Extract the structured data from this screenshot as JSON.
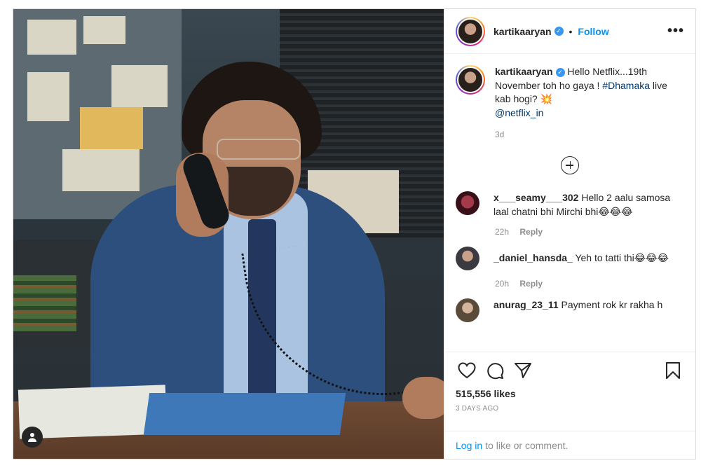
{
  "post": {
    "username": "kartikaaryan",
    "follow_label": "Follow",
    "separator": "•",
    "more_icon": "•••"
  },
  "caption": {
    "username": "kartikaaryan",
    "text_1": "Hello Netflix...19th November toh ho gaya ! ",
    "hashtag": "#Dhamaka",
    "text_2": " live kab hogi? 💥",
    "mention": "@netflix_in",
    "age": "3d"
  },
  "comments": [
    {
      "username": "x___seamy___302",
      "text": "Hello 2 aalu samosa laal chatni bhi Mirchi bhi😂😂😂",
      "age": "22h",
      "reply": "Reply",
      "avatar_color": "#6b1f2a"
    },
    {
      "username": "_daniel_hansda_",
      "text": "Yeh to tatti thi😂😂😂",
      "age": "20h",
      "reply": "Reply",
      "avatar_color": "#4a4a52"
    },
    {
      "username": "anurag_23_11",
      "text": "Payment rok kr rakha h",
      "age": "",
      "reply": "",
      "avatar_color": "#7a6a58"
    }
  ],
  "stats": {
    "likes": "515,556 likes",
    "posted": "3 DAYS AGO"
  },
  "login": {
    "link": "Log in",
    "text": "to like or comment."
  }
}
